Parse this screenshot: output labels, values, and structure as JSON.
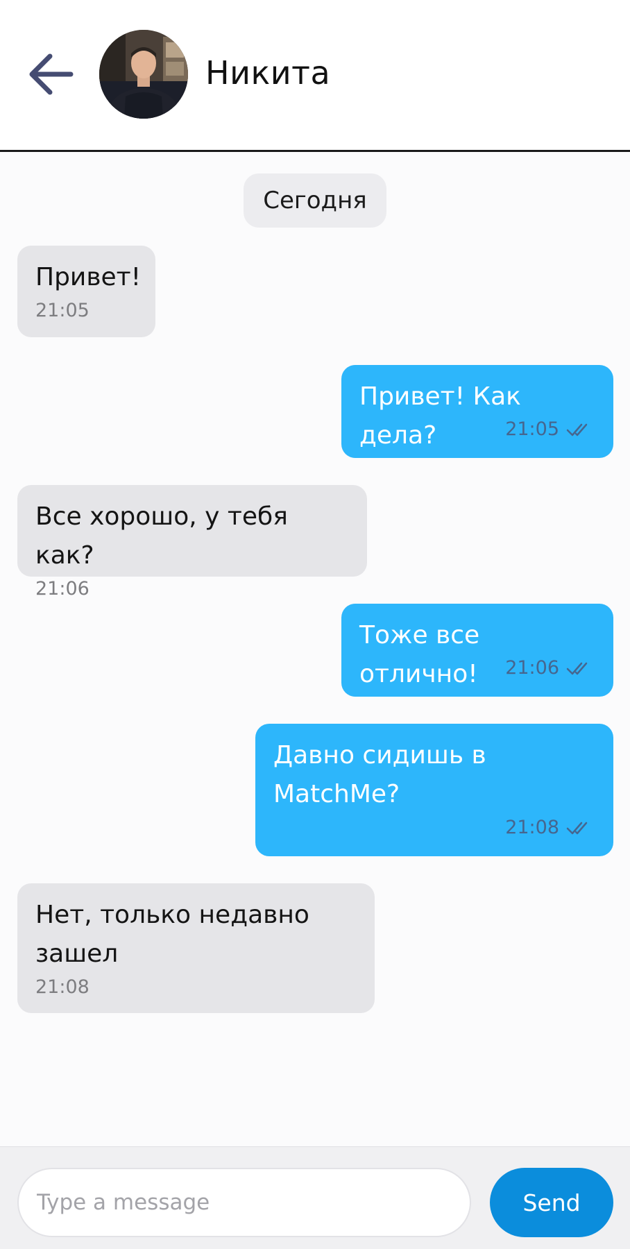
{
  "header": {
    "contact_name": "Никита"
  },
  "date_divider": "Сегодня",
  "messages": [
    {
      "direction": "in",
      "text": "Привет!",
      "time": "21:05"
    },
    {
      "direction": "out",
      "text": "Привет! Как дела?",
      "time": "21:05",
      "status": "read"
    },
    {
      "direction": "in",
      "text": "Все хорошо, у тебя как?",
      "time": "21:06"
    },
    {
      "direction": "out",
      "text": "Тоже все отлично!",
      "time": "21:06",
      "status": "read"
    },
    {
      "direction": "out",
      "text": "Давно сидишь в MatchMe?",
      "time": "21:08",
      "status": "read"
    },
    {
      "direction": "in",
      "text": "Нет, только недавно зашел",
      "time": "21:08"
    }
  ],
  "composer": {
    "placeholder": "Type a message",
    "send_label": "Send"
  },
  "colors": {
    "incoming_bubble": "#e5e5e8",
    "outgoing_bubble": "#2db6fb",
    "send_button": "#0b8ddc",
    "back_arrow": "#454c72"
  },
  "icons": {
    "back": "arrow-left-icon",
    "read_receipt": "double-check-icon"
  }
}
